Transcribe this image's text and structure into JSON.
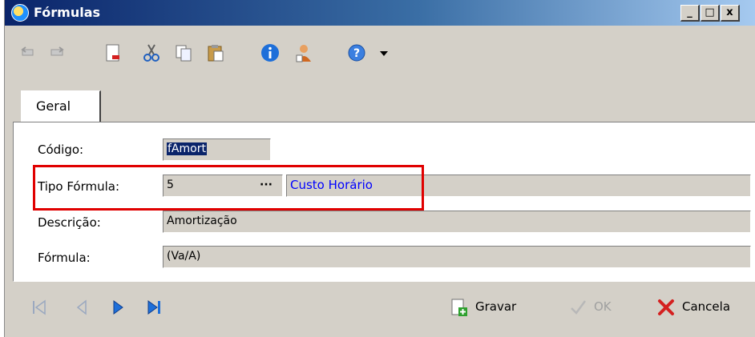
{
  "window": {
    "title": "Fórmulas",
    "controls": {
      "minimize": "_",
      "maximize": "□",
      "close": "x"
    }
  },
  "toolbar": {
    "icons": [
      "undo-icon",
      "redo-icon",
      "new-document-icon",
      "cut-icon",
      "copy-icon",
      "paste-icon",
      "info-icon",
      "user-icon",
      "help-icon"
    ]
  },
  "tabs": [
    {
      "label": "Geral",
      "active": true
    }
  ],
  "form": {
    "codigo": {
      "label": "Código:",
      "value": "fAmort"
    },
    "tipo_formula": {
      "label": "Tipo Fórmula:",
      "value": "5",
      "lookup_button": "···",
      "description": "Custo Horário"
    },
    "descricao": {
      "label": "Descrição:",
      "value": "Amortização"
    },
    "formula": {
      "label": "Fórmula:",
      "value": "(Va/A)"
    }
  },
  "navigation": [
    "first-record-icon",
    "previous-record-icon",
    "next-record-icon",
    "last-record-icon"
  ],
  "actions": {
    "gravar": "Gravar",
    "ok": "OK",
    "cancela": "Cancela"
  },
  "colors": {
    "highlight": "#e00000",
    "link": "#0000ff",
    "nav_blue": "#1e6fd9",
    "cancel_red": "#d42020"
  }
}
